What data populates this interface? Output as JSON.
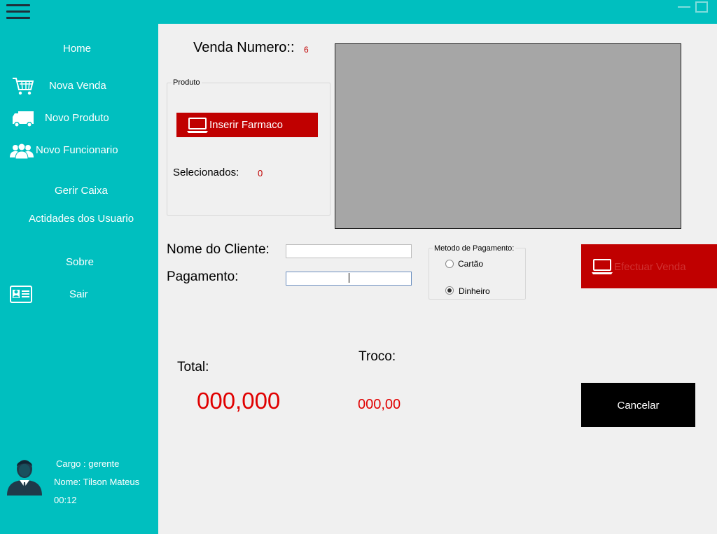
{
  "sidebar": {
    "items": [
      {
        "label": "Home"
      },
      {
        "label": "Nova Venda",
        "icon": "cart-icon"
      },
      {
        "label": "Novo Produto",
        "icon": "truck-icon"
      },
      {
        "label": "Novo Funcionario",
        "icon": "users-icon"
      },
      {
        "label": "Gerir Caixa"
      },
      {
        "label": "Actidades dos Usuario"
      },
      {
        "label": "Sobre"
      },
      {
        "label": "Sair",
        "icon": "id-card-icon"
      }
    ],
    "user": {
      "cargo": "Cargo : gerente",
      "nome": "Nome: Tilson Mateus",
      "time": "00:12"
    }
  },
  "venda": {
    "label": "Venda Numero::",
    "number": "6"
  },
  "produto": {
    "legend": "Produto",
    "inserir_label": "Inserir Farmaco",
    "selecionados_label": "Selecionados:",
    "selecionados_value": "0"
  },
  "form": {
    "cliente_label": "Nome do Cliente:",
    "cliente_value": "",
    "pagamento_label": "Pagamento:",
    "pagamento_value": ""
  },
  "payment_method": {
    "legend": "Metodo de Pagamento:",
    "options": [
      {
        "label": "Cartão",
        "selected": false
      },
      {
        "label": "Dinheiro",
        "selected": true
      }
    ]
  },
  "actions": {
    "efectuar_label": "Efectuar Venda",
    "cancelar_label": "Cancelar"
  },
  "totals": {
    "total_label": "Total:",
    "total_value": "000,000",
    "troco_label": "Troco:",
    "troco_value": "000,00"
  },
  "colors": {
    "sidebar": "#00bfbf",
    "accent_red": "#c00000",
    "value_red": "#e00000"
  }
}
